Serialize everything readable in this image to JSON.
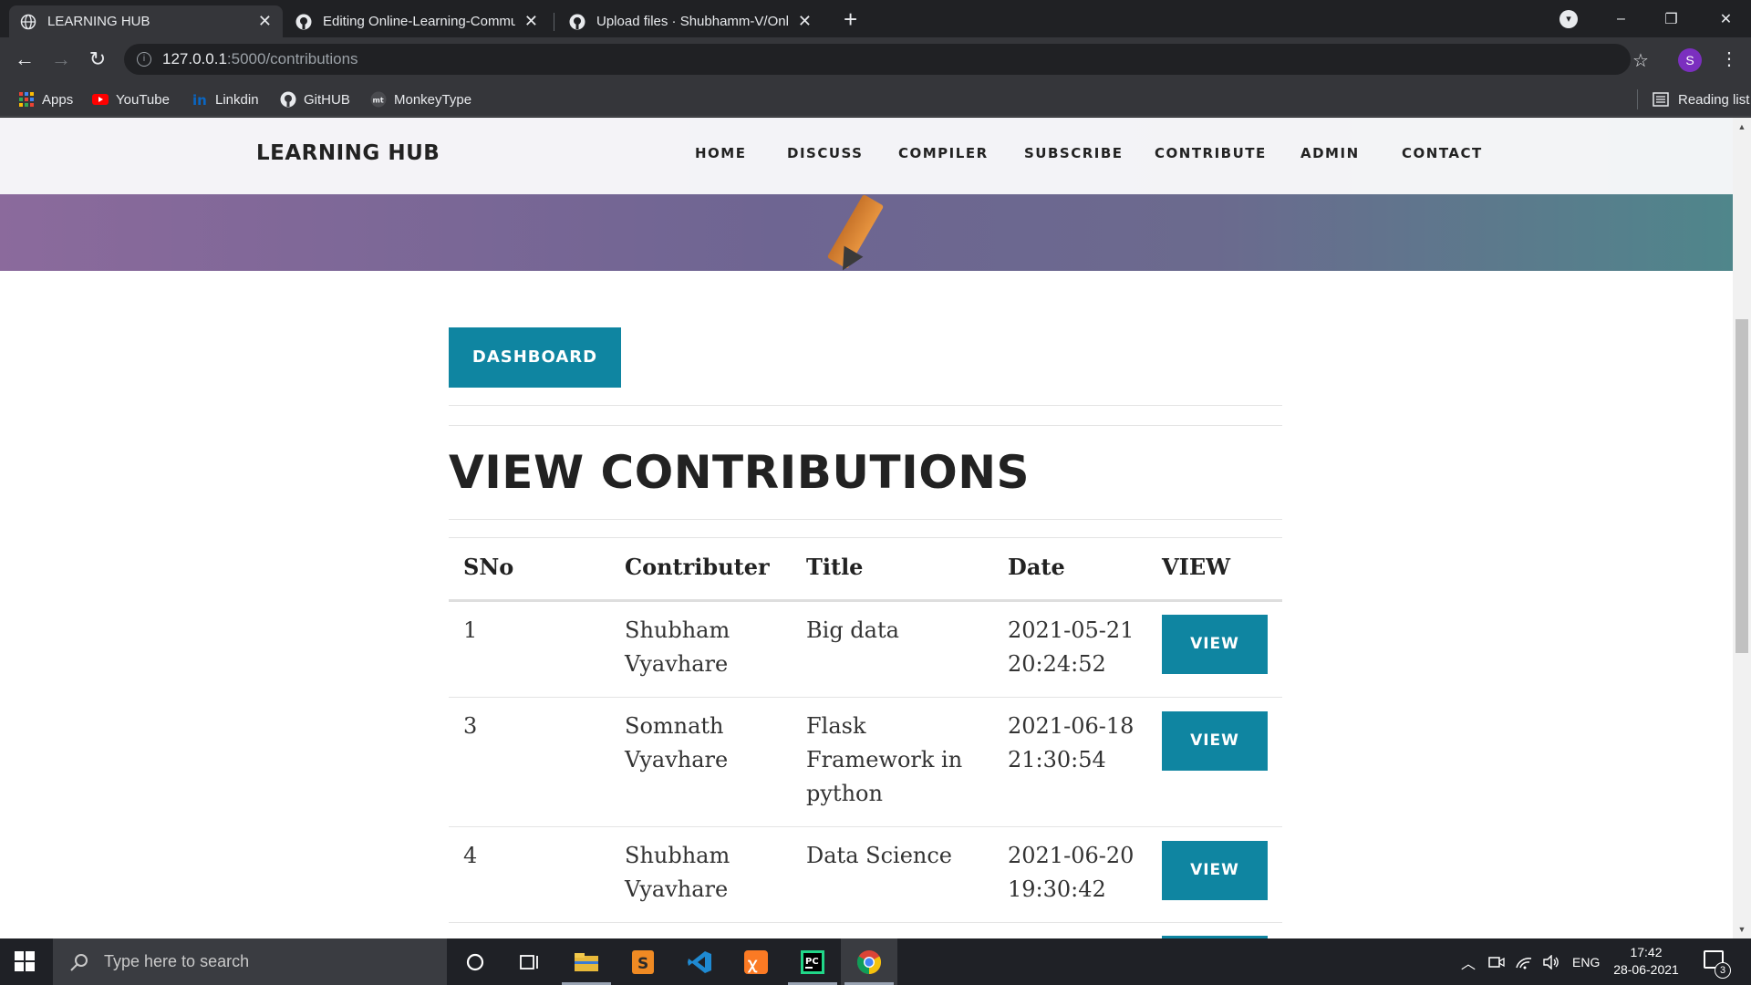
{
  "browser": {
    "tabs": [
      {
        "title": "LEARNING HUB",
        "active": true
      },
      {
        "title": "Editing Online-Learning-Commu",
        "active": false
      },
      {
        "title": "Upload files · Shubhamm-V/Onli",
        "active": false
      }
    ],
    "new_tab": "+",
    "url_host": "127.0.0.1",
    "url_path": ":5000/contributions",
    "profile_initial": "S",
    "window_controls": {
      "minimize": "–",
      "restore": "❐",
      "close": "✕"
    }
  },
  "bookmarks": [
    {
      "label": "Apps",
      "icon": "apps-grid-icon"
    },
    {
      "label": "YouTube",
      "icon": "youtube-icon"
    },
    {
      "label": "Linkdin",
      "icon": "linkedin-icon"
    },
    {
      "label": "GitHUB",
      "icon": "github-icon"
    },
    {
      "label": "MonkeyType",
      "icon": "monkeytype-icon"
    }
  ],
  "reading_list": "Reading list",
  "site": {
    "logo": "LEARNING HUB",
    "nav": [
      "HOME",
      "DISCUSS",
      "COMPILER",
      "SUBSCRIBE",
      "CONTRIBUTE",
      "ADMIN",
      "CONTACT"
    ]
  },
  "main": {
    "dashboard_button": "DASHBOARD",
    "heading": "VIEW CONTRIBUTIONS",
    "table": {
      "headers": [
        "SNo",
        "Contributer",
        "Title",
        "Date",
        "VIEW"
      ],
      "rows": [
        {
          "sno": "1",
          "contributer": [
            "Shubham",
            "Vyavhare"
          ],
          "title": [
            "Big data"
          ],
          "date": [
            "2021-05-21",
            "20:24:52"
          ],
          "action": "VIEW"
        },
        {
          "sno": "3",
          "contributer": [
            "Somnath",
            "Vyavhare"
          ],
          "title": [
            "Flask",
            "Framework in",
            "python"
          ],
          "date": [
            "2021-06-18",
            "21:30:54"
          ],
          "action": "VIEW"
        },
        {
          "sno": "4",
          "contributer": [
            "Shubham",
            "Vyavhare"
          ],
          "title": [
            "Data Science"
          ],
          "date": [
            "2021-06-20",
            "19:30:42"
          ],
          "action": "VIEW"
        }
      ]
    }
  },
  "taskbar": {
    "search_placeholder": "Type here to search",
    "language": "ENG",
    "time": "17:42",
    "date": "28-06-2021",
    "notification_count": "3"
  },
  "colors": {
    "accent": "#0f85a1",
    "browser_dark": "#202124",
    "taskbar": "#1f2126"
  }
}
